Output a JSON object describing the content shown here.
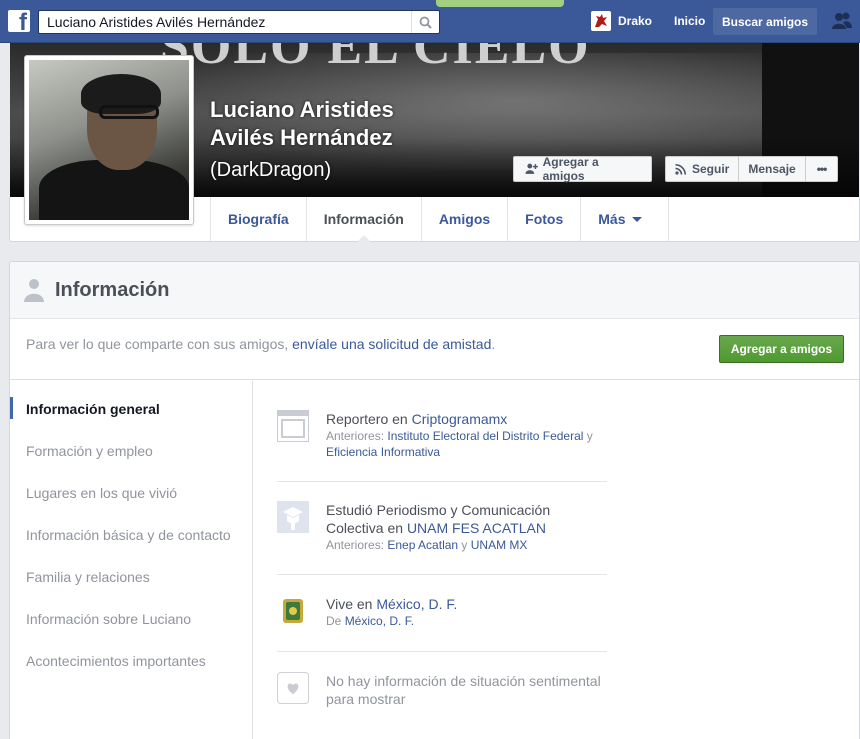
{
  "topbar": {
    "search_value": "Luciano Aristides Avilés Hernández",
    "user_name": "Drako",
    "home": "Inicio",
    "find_friends": "Buscar amigos"
  },
  "profile": {
    "name_line1": "Luciano Aristides",
    "name_line2": "Avilés Hernández",
    "alt_name": "(DarkDragon)",
    "cover_text": "SOLO EL CIELO",
    "buttons": {
      "add_friend": "Agregar a amigos",
      "follow": "Seguir",
      "message": "Mensaje",
      "more": "•••"
    }
  },
  "tabs": [
    {
      "label": "Biografía"
    },
    {
      "label": "Información"
    },
    {
      "label": "Amigos"
    },
    {
      "label": "Fotos"
    },
    {
      "label": "Más"
    }
  ],
  "info": {
    "title": "Información",
    "notice_prefix": "Para ver lo que comparte con sus amigos, ",
    "notice_link": "envíale una solicitud de amistad",
    "notice_suffix": ".",
    "add_friend_button": "Agregar a amigos",
    "sidenav": [
      "Información general",
      "Formación y empleo",
      "Lugares en los que vivió",
      "Información básica y de contacto",
      "Familia y relaciones",
      "Información sobre Luciano",
      "Acontecimientos importantes"
    ],
    "work": {
      "prefix": "Reportero en ",
      "employer": "Criptogramamx",
      "previous_label": "Anteriores: ",
      "previous_1": "Instituto Electoral del Distrito Federal",
      "joiner": " y ",
      "previous_2": "Eficiencia Informativa"
    },
    "education": {
      "line1": "Estudió Periodismo y Comunicación",
      "line2_prefix": "Colectiva en ",
      "school": "UNAM FES ACATLAN",
      "previous_label": "Anteriores: ",
      "previous_1": "Enep Acatlan",
      "joiner": " y ",
      "previous_2": "UNAM MX"
    },
    "places": {
      "prefix": "Vive en ",
      "current": "México, D. F.",
      "from_label": "De ",
      "from": "México, D. F."
    },
    "relationship": {
      "line1": "No hay información de situación sentimental",
      "line2": "para mostrar"
    }
  },
  "colors": {
    "brand_blue": "#3b5998",
    "green_button": "#4e9a2f",
    "page_bg": "#e9eaed"
  }
}
